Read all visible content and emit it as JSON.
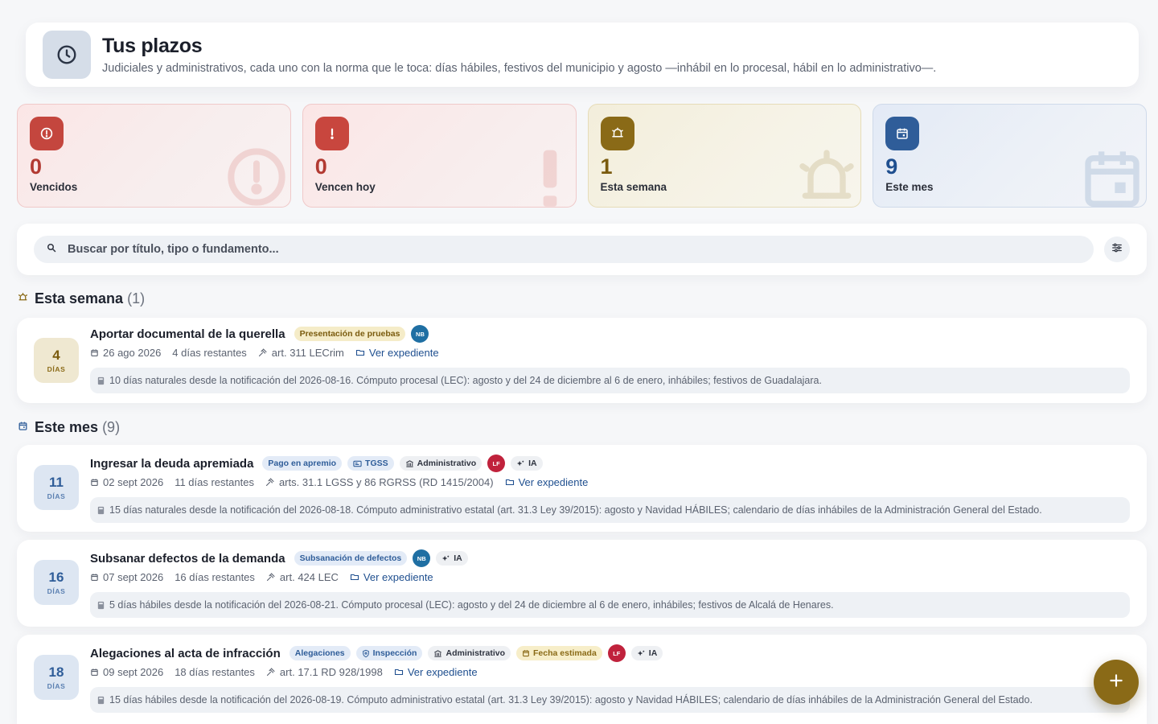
{
  "header": {
    "title": "Tus plazos",
    "subtitle": "Judiciales y administrativos, cada uno con la norma que le toca: días hábiles, festivos del municipio y agosto —inhábil en lo procesal, hábil en lo administrativo—.",
    "icon": "clock-icon"
  },
  "stats": [
    {
      "count": "0",
      "label": "Vencidos",
      "icon": "alert-circle-icon",
      "color": "#c4463e"
    },
    {
      "count": "0",
      "label": "Vencen hoy",
      "icon": "exclamation-icon",
      "color": "#c8463e"
    },
    {
      "count": "1",
      "label": "Esta semana",
      "icon": "alarm-bell-icon",
      "color": "#8a6a17"
    },
    {
      "count": "9",
      "label": "Este mes",
      "icon": "calendar-icon",
      "color": "#2f5d99"
    }
  ],
  "search": {
    "placeholder": "Buscar por título, tipo o fundamento...",
    "filter_icon": "sliders-icon"
  },
  "sections": [
    {
      "title": "Esta semana",
      "count": "(1)",
      "items": [
        {
          "days": "4",
          "unit": "DÍAS",
          "title": "Aportar documental de la querella",
          "tags": [
            "Presentación de pruebas"
          ],
          "assignee": "NB",
          "date": "26 ago 2026",
          "remaining": "4 días restantes",
          "basis": "art. 311 LECrim",
          "link": "Ver expediente",
          "note": "10 días naturales desde la notificación del 2026-08-16. Cómputo procesal (LEC): agosto y del 24 de diciembre al 6 de enero, inhábiles; festivos de Guadalajara."
        }
      ]
    },
    {
      "title": "Este mes",
      "count": "(9)",
      "items": [
        {
          "days": "11",
          "unit": "DÍAS",
          "title": "Ingresar la deuda apremiada",
          "tags": [
            "Pago en apremio",
            "TGSS",
            "Administrativo"
          ],
          "assignee": "LF",
          "ai": "IA",
          "date": "02 sept 2026",
          "remaining": "11 días restantes",
          "basis": "arts. 31.1 LGSS y 86 RGRSS (RD 1415/2004)",
          "link": "Ver expediente",
          "note": "15 días naturales desde la notificación del 2026-08-18. Cómputo administrativo estatal (art. 31.3 Ley 39/2015): agosto y Navidad HÁBILES; calendario de días inhábiles de la Administración General del Estado."
        },
        {
          "days": "16",
          "unit": "DÍAS",
          "title": "Subsanar defectos de la demanda",
          "tags": [
            "Subsanación de defectos"
          ],
          "assignee": "NB",
          "ai": "IA",
          "date": "07 sept 2026",
          "remaining": "16 días restantes",
          "basis": "art. 424 LEC",
          "link": "Ver expediente",
          "note": "5 días hábiles desde la notificación del 2026-08-21. Cómputo procesal (LEC): agosto y del 24 de diciembre al 6 de enero, inhábiles; festivos de Alcalá de Henares."
        },
        {
          "days": "18",
          "unit": "DÍAS",
          "title": "Alegaciones al acta de infracción",
          "tags": [
            "Alegaciones",
            "Inspección",
            "Administrativo",
            "Fecha estimada"
          ],
          "assignee": "LF",
          "ai": "IA",
          "date": "09 sept 2026",
          "remaining": "18 días restantes",
          "basis": "art. 17.1 RD 928/1998",
          "link": "Ver expediente",
          "note": "15 días hábiles desde la notificación del 2026-08-19. Cómputo administrativo estatal (art. 31.3 Ley 39/2015): agosto y Navidad HÁBILES; calendario de días inhábiles de la Administración General del Estado."
        }
      ]
    }
  ],
  "fab": {
    "icon": "plus-icon"
  }
}
